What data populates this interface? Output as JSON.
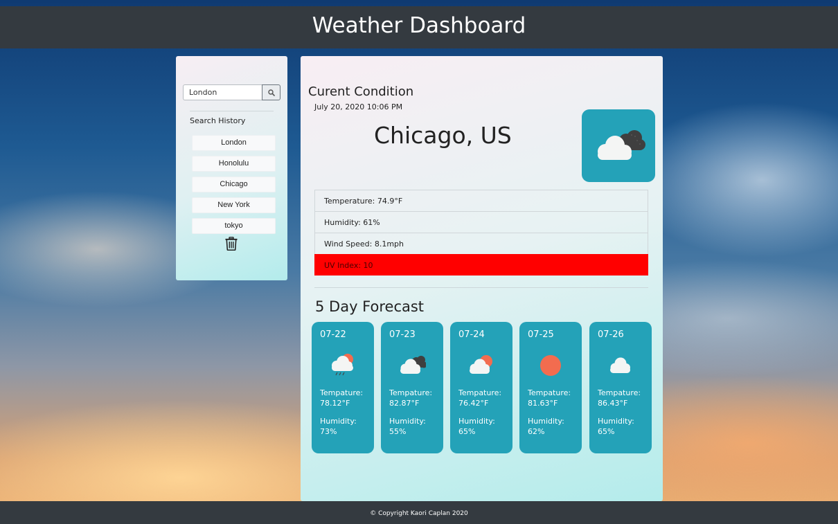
{
  "header": {
    "title": "Weather Dashboard"
  },
  "sidebar": {
    "search": {
      "value": "London",
      "icon": "search-icon"
    },
    "history_title": "Search History",
    "history": [
      "London",
      "Honolulu",
      "Chicago",
      "New York",
      "tokyo"
    ],
    "trash_icon": "trash-icon"
  },
  "current": {
    "title": "Curent Condition",
    "date": "July 20, 2020 10:06 PM",
    "city": "Chicago, US",
    "icon": "cloudy-icon",
    "temperature": "Temperature: 74.9°F",
    "humidity": "Humidity: 61%",
    "wind": "Wind Speed: 8.1mph",
    "uv": "UV Index: 10",
    "uv_color": "#ff0000",
    "accent_color": "#24a2b8"
  },
  "forecast": {
    "title": "5 Day Forecast",
    "days": [
      {
        "date": "07-22",
        "icon": "rain-sun-icon",
        "temp_label": "Tempature:",
        "temp": "78.12°F",
        "hum_label": "Humidity:",
        "hum": "73%"
      },
      {
        "date": "07-23",
        "icon": "cloudy-icon",
        "temp_label": "Tempature:",
        "temp": "82.87°F",
        "hum_label": "Humidity:",
        "hum": "55%"
      },
      {
        "date": "07-24",
        "icon": "partly-cloudy-icon",
        "temp_label": "Tempature:",
        "temp": "76.42°F",
        "hum_label": "Humidity:",
        "hum": "65%"
      },
      {
        "date": "07-25",
        "icon": "sun-icon",
        "temp_label": "Tempature:",
        "temp": "81.63°F",
        "hum_label": "Humidity:",
        "hum": "62%"
      },
      {
        "date": "07-26",
        "icon": "cloud-icon",
        "temp_label": "Tempature:",
        "temp": "86.43°F",
        "hum_label": "Humidity:",
        "hum": "65%"
      }
    ]
  },
  "footer": {
    "text": "© Copyright Kaori Caplan 2020"
  }
}
